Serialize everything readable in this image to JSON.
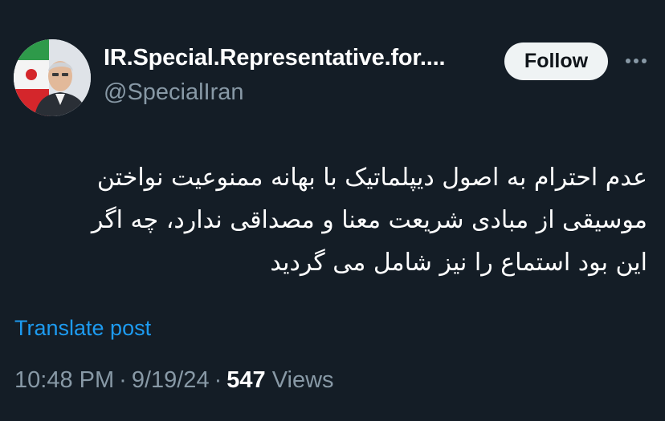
{
  "author": {
    "display_name": "IR.Special.Representative.for....",
    "handle": "@SpecialIran",
    "avatar_icon": "profile-photo"
  },
  "actions": {
    "follow_label": "Follow",
    "more_icon": "more-horizontal-icon"
  },
  "tweet": {
    "lines": [
      "عدم احترام به اصول دیپلماتیک با بهانه ممنوعیت نواختن",
      "موسیقی از مبادی شریعت معنا و مصداقی ندارد، چه اگر",
      "این بود استماع را نیز شامل می گردید"
    ]
  },
  "translate": {
    "label": "Translate post"
  },
  "meta": {
    "time": "10:48 PM",
    "separator": "·",
    "date": "9/19/24",
    "views_count": "547",
    "views_label": "Views"
  },
  "colors": {
    "background": "#141d26",
    "text_primary": "#ffffff",
    "text_secondary": "#8899a6",
    "link": "#1d9bf0",
    "button_bg": "#eff3f4",
    "button_text": "#0f1419"
  }
}
